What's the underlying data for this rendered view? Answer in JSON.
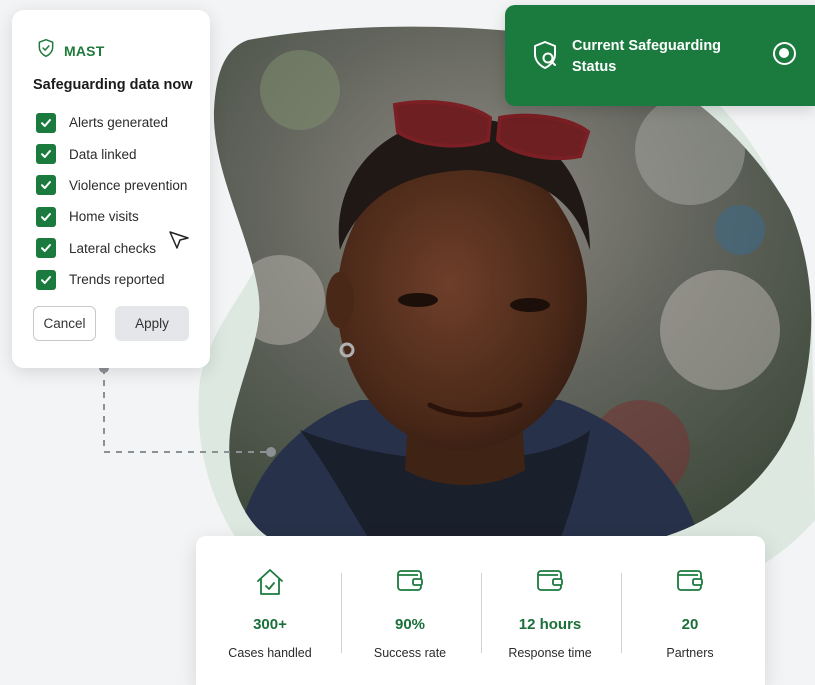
{
  "colors": {
    "brand_green": "#1b7a3e",
    "dark_green": "#1b6f3a",
    "blob_green": "#dfe8e2",
    "background": "#f3f4f5"
  },
  "filter_panel": {
    "brand": "MAST",
    "brand_icon": "shield-check-icon",
    "title": "Safeguarding data now",
    "items": [
      {
        "label": "Alerts generated",
        "checked": true
      },
      {
        "label": "Data linked",
        "checked": true
      },
      {
        "label": "Violence prevention",
        "checked": true
      },
      {
        "label": "Home visits",
        "checked": true
      },
      {
        "label": "Lateral checks",
        "checked": true
      },
      {
        "label": "Trends reported",
        "checked": true
      }
    ],
    "cancel_label": "Cancel",
    "apply_label": "Apply"
  },
  "status_card": {
    "icon": "shield-search-icon",
    "title": "Current Safeguarding Status",
    "selected": true
  },
  "photo": {
    "description": "portrait-photo"
  },
  "stats": [
    {
      "icon": "house-check-icon",
      "value": "300+",
      "label": "Cases handled"
    },
    {
      "icon": "wallet-icon",
      "value": "90%",
      "label": "Success rate"
    },
    {
      "icon": "wallet-icon",
      "value": "12 hours",
      "label": "Response time"
    },
    {
      "icon": "wallet-icon",
      "value": "20",
      "label": "Partners"
    }
  ]
}
